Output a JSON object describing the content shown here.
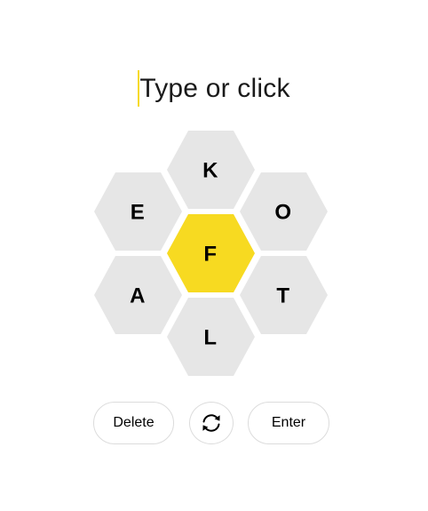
{
  "input": {
    "placeholder": "Type or click"
  },
  "hive": {
    "center_letter": "F",
    "outer_letters": [
      "K",
      "O",
      "T",
      "L",
      "A",
      "E"
    ],
    "center_color": "#f7da21",
    "outer_color": "#e6e6e6"
  },
  "controls": {
    "delete_label": "Delete",
    "shuffle_icon": "shuffle-icon",
    "enter_label": "Enter"
  }
}
